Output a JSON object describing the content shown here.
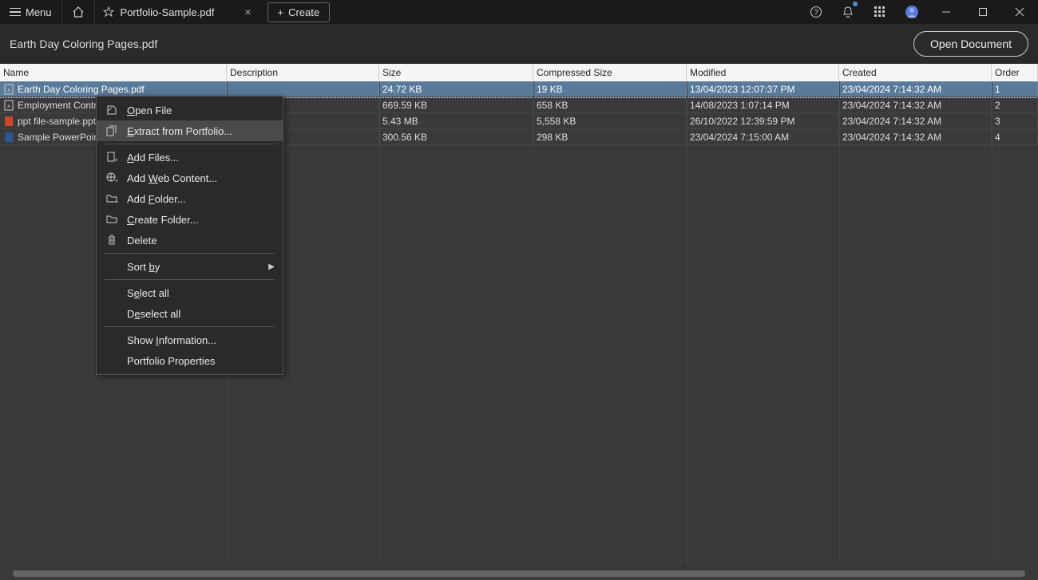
{
  "titlebar": {
    "menu_label": "Menu",
    "tab_title": "Portfolio-Sample.pdf",
    "create_label": "Create"
  },
  "subheader": {
    "title": "Earth Day Coloring Pages.pdf",
    "open_doc_label": "Open Document"
  },
  "columns": {
    "name": "Name",
    "description": "Description",
    "size": "Size",
    "compressed": "Compressed Size",
    "modified": "Modified",
    "created": "Created",
    "order": "Order"
  },
  "rows": [
    {
      "name": "Earth Day Coloring Pages.pdf",
      "desc": "",
      "size": "24.72 KB",
      "compressed": "19 KB",
      "modified": "13/04/2023 12:07:37 PM",
      "created": "23/04/2024 7:14:32 AM",
      "order": "1",
      "icon": "pdf"
    },
    {
      "name": "Employment Contract",
      "desc": "",
      "size": "669.59 KB",
      "compressed": "658 KB",
      "modified": "14/08/2023 1:07:14 PM",
      "created": "23/04/2024 7:14:32 AM",
      "order": "2",
      "icon": "pdf"
    },
    {
      "name": "ppt file-sample.pptx",
      "desc": "",
      "size": "5.43 MB",
      "compressed": "5,558 KB",
      "modified": "26/10/2022 12:39:59 PM",
      "created": "23/04/2024 7:14:32 AM",
      "order": "3",
      "icon": "ppt"
    },
    {
      "name": "Sample PowerPoint.d",
      "desc": "",
      "size": "300.56 KB",
      "compressed": "298 KB",
      "modified": "23/04/2024 7:15:00 AM",
      "created": "23/04/2024 7:14:32 AM",
      "order": "4",
      "icon": "doc"
    }
  ],
  "context_menu": {
    "open_file": "Open File",
    "extract": "Extract from Portfolio...",
    "add_files": "Add Files...",
    "add_web": "Add Web Content...",
    "add_folder": "Add Folder...",
    "create_folder": "Create Folder...",
    "delete": "Delete",
    "sort_by": "Sort by",
    "select_all": "Select all",
    "deselect_all": "Deselect all",
    "show_info": "Show Information...",
    "portfolio_props": "Portfolio Properties"
  }
}
